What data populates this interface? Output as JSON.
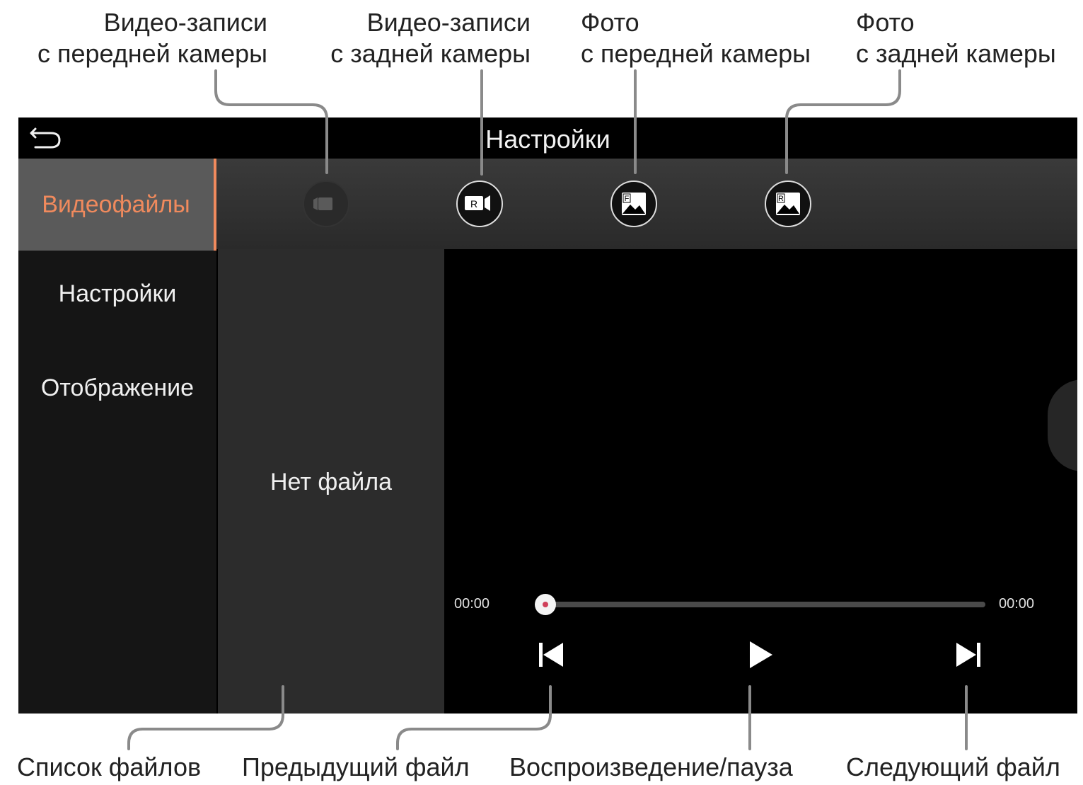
{
  "callouts": {
    "front_video": "Видео-записи\nс передней камеры",
    "rear_video": "Видео-записи\nс задней камеры",
    "front_photo": "Фото\nс передней камеры",
    "rear_photo": "Фото\nс задней камеры",
    "file_list": "Список файлов",
    "prev_file": "Предыдущий файл",
    "play_pause": "Воспроизведение/пауза",
    "next_file": "Следующий файл"
  },
  "screen": {
    "title": "Настройки",
    "sidebar": {
      "items": [
        {
          "label": "Видеофайлы",
          "active": true
        },
        {
          "label": "Настройки",
          "active": false
        },
        {
          "label": "Отображение",
          "active": false
        }
      ]
    },
    "camera_tabs": {
      "rear_video_badge": "R",
      "front_photo_badge": "F",
      "rear_photo_badge": "R"
    },
    "file_list": {
      "empty_text": "Нет файла"
    },
    "player": {
      "time_current": "00:00",
      "time_total": "00:00",
      "progress": 0
    }
  },
  "colors": {
    "accent": "#f08a5d",
    "background": "#000000",
    "sidebar_active_bg": "#5a5a5a",
    "leader_line": "#8a8a8a"
  },
  "icons": {
    "back": "back-arrow-icon",
    "front_video": "video-camera-icon",
    "rear_video": "rear-video-camera-icon",
    "front_photo": "front-photo-icon",
    "rear_photo": "rear-photo-icon",
    "prev": "skip-previous-icon",
    "play": "play-icon",
    "next": "skip-next-icon"
  }
}
